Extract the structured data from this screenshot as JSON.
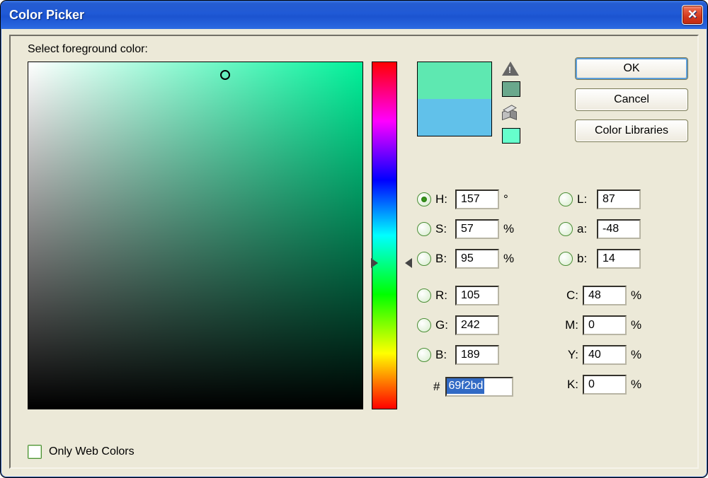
{
  "window": {
    "title": "Color Picker"
  },
  "label": "Select foreground color:",
  "buttons": {
    "ok": "OK",
    "cancel": "Cancel",
    "libraries": "Color Libraries"
  },
  "swatch": {
    "new": "#5ee8b1",
    "old": "#61c1ea",
    "gamut_swatch": "#6aa88c",
    "websafe_swatch": "#66ffcc"
  },
  "hsb": {
    "h": {
      "label": "H:",
      "value": "157",
      "suffix": "°",
      "selected": true
    },
    "s": {
      "label": "S:",
      "value": "57",
      "suffix": "%",
      "selected": false
    },
    "b": {
      "label": "B:",
      "value": "95",
      "suffix": "%",
      "selected": false
    }
  },
  "rgb": {
    "r": {
      "label": "R:",
      "value": "105",
      "selected": false
    },
    "g": {
      "label": "G:",
      "value": "242",
      "selected": false
    },
    "b": {
      "label": "B:",
      "value": "189",
      "selected": false
    }
  },
  "lab": {
    "l": {
      "label": "L:",
      "value": "87",
      "selected": false
    },
    "a": {
      "label": "a:",
      "value": "-48",
      "selected": false
    },
    "b": {
      "label": "b:",
      "value": "14",
      "selected": false
    }
  },
  "cmyk": {
    "c": {
      "label": "C:",
      "value": "48",
      "suffix": "%"
    },
    "m": {
      "label": "M:",
      "value": "0",
      "suffix": "%"
    },
    "y": {
      "label": "Y:",
      "value": "40",
      "suffix": "%"
    },
    "k": {
      "label": "K:",
      "value": "0",
      "suffix": "%"
    }
  },
  "hex": {
    "label": "#",
    "value": "69f2bd"
  },
  "web_only": {
    "label": "Only Web Colors",
    "checked": false
  }
}
